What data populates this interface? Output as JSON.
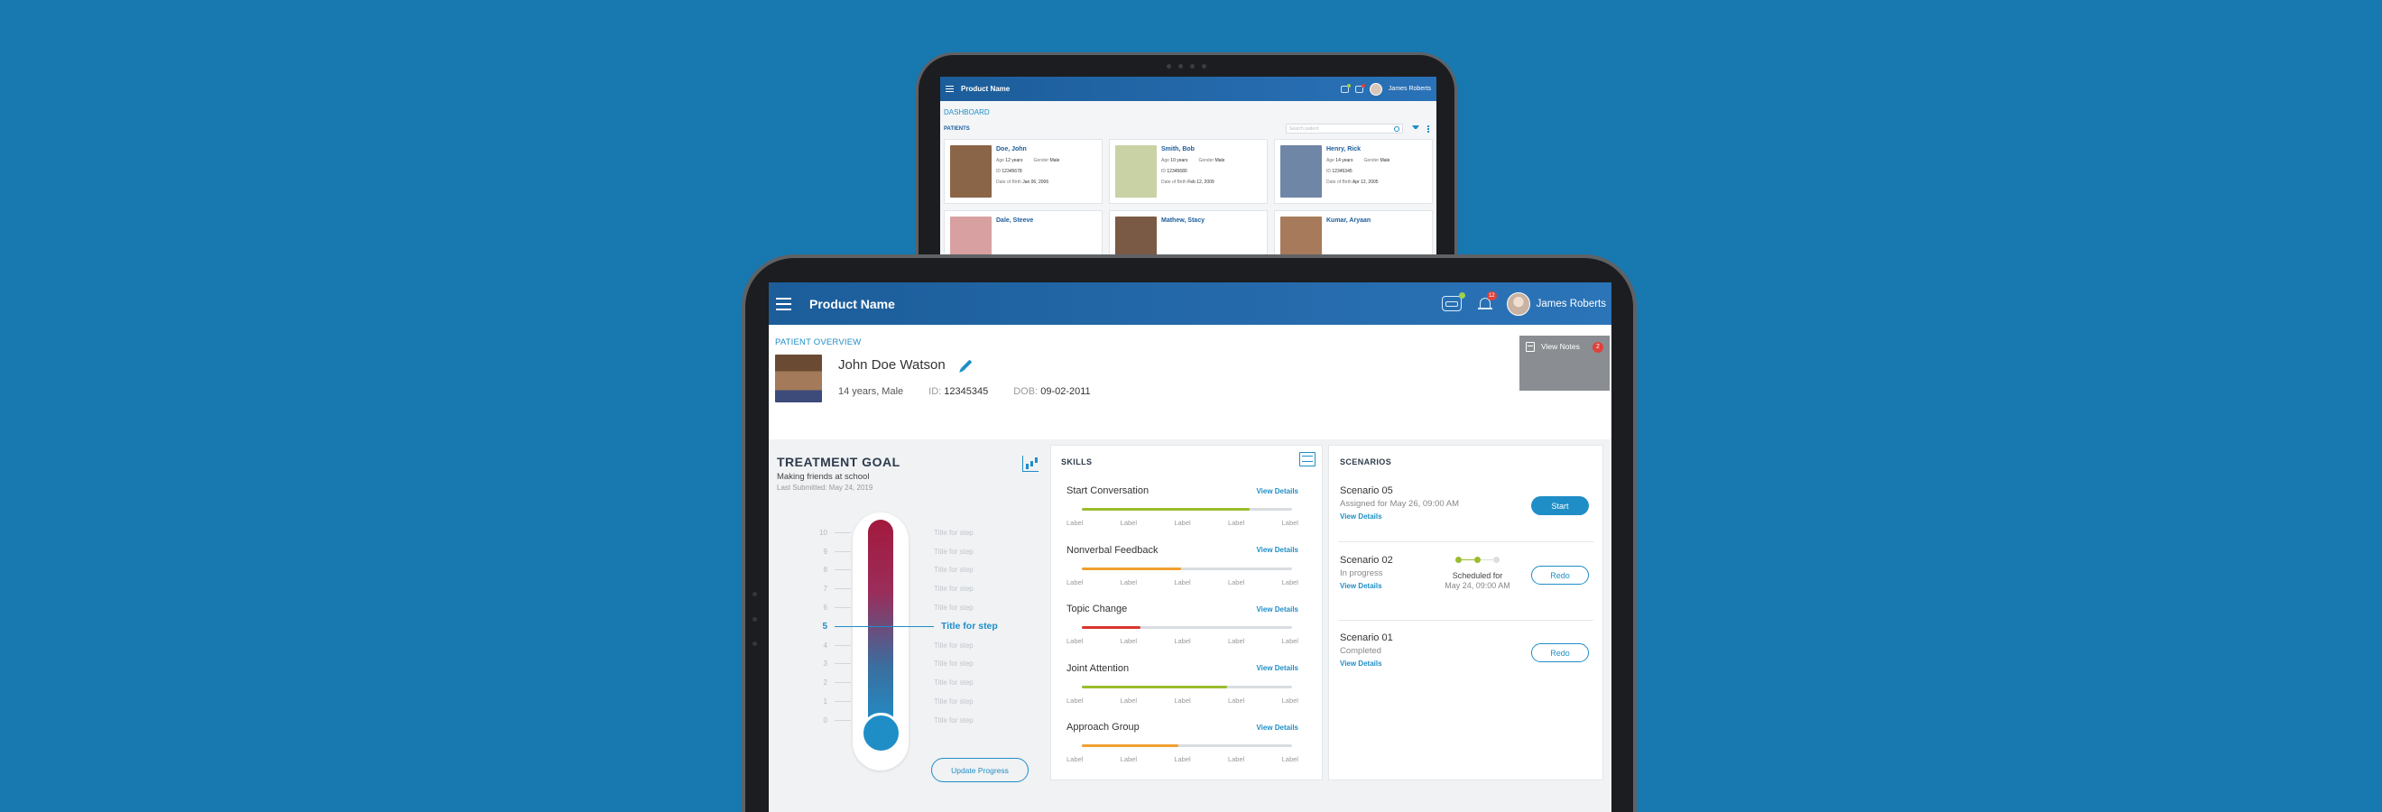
{
  "back_screen": {
    "header": {
      "title": "Product Name",
      "user": "James Roberts"
    },
    "breadcrumb": "DASHBOARD",
    "section_label": "PATIENTS",
    "search_placeholder": "Search patient",
    "patients": [
      {
        "name": "Doe, John",
        "age_label": "Age",
        "age": "12 years",
        "gender_label": "Gender",
        "gender": "Male",
        "id_label": "ID",
        "id": "12345678",
        "dob_label": "Date of Birth",
        "dob": "Jan 06, 2006",
        "photo_color": "#8a6548"
      },
      {
        "name": "Smith, Bob",
        "age_label": "Age",
        "age": "10 years",
        "gender_label": "Gender",
        "gender": "Male",
        "id_label": "ID",
        "id": "12345680",
        "dob_label": "Date of Birth",
        "dob": "Feb 12, 2009",
        "photo_color": "#c9d2a4"
      },
      {
        "name": "Henry, Rick",
        "age_label": "Age",
        "age": "14 years",
        "gender_label": "Gender",
        "gender": "Male",
        "id_label": "ID",
        "id": "12345345",
        "dob_label": "Date of Birth",
        "dob": "Apr 12, 2005",
        "photo_color": "#6f86a6"
      },
      {
        "name": "Dale, Steeve",
        "photo_color": "#d8a0a0"
      },
      {
        "name": "Mathew, Stacy",
        "photo_color": "#7a5a45"
      },
      {
        "name": "Kumar, Aryaan",
        "photo_color": "#a67a5a"
      }
    ]
  },
  "header": {
    "title": "Product Name",
    "notification_count": "12",
    "user_name": "James Roberts"
  },
  "overview": {
    "breadcrumb": "PATIENT OVERVIEW",
    "name": "John Doe Watson",
    "age_gender": "14 years, Male",
    "id_label": "ID:",
    "id": "12345345",
    "dob_label": "DOB:",
    "dob": "09-02-2011",
    "notes_label": "View Notes",
    "notes_count": "2"
  },
  "goal": {
    "title": "TREATMENT GOAL",
    "subtitle": "Making friends at school",
    "submitted": "Last Submitted: May 24, 2019",
    "steps": [
      {
        "num": "10",
        "label": "Title for step"
      },
      {
        "num": "9",
        "label": "Title for step"
      },
      {
        "num": "8",
        "label": "Title for step"
      },
      {
        "num": "7",
        "label": "Title for step"
      },
      {
        "num": "6",
        "label": "Title for step"
      },
      {
        "num": "5",
        "label": "Title for step",
        "active": true
      },
      {
        "num": "4",
        "label": "Title for step"
      },
      {
        "num": "3",
        "label": "Title for step"
      },
      {
        "num": "2",
        "label": "Title for step"
      },
      {
        "num": "1",
        "label": "Title for step"
      },
      {
        "num": "0",
        "label": "Title for step"
      }
    ],
    "update_label": "Update Progress"
  },
  "skills": {
    "title": "SKILLS",
    "view_label": "View Details",
    "tick_label": "Label",
    "items": [
      {
        "name": "Start Conversation",
        "progress": 0.8,
        "color": "#9bbc2c"
      },
      {
        "name": "Nonverbal Feedback",
        "progress": 0.47,
        "color": "#f0a030"
      },
      {
        "name": "Topic Change",
        "progress": 0.28,
        "color": "#d9362f"
      },
      {
        "name": "Joint Attention",
        "progress": 0.69,
        "color": "#9bbc2c"
      },
      {
        "name": "Approach Group",
        "progress": 0.46,
        "color": "#f0a030"
      }
    ]
  },
  "scenarios": {
    "title": "SCENARIOS",
    "view_label": "View Details",
    "items": [
      {
        "name": "Scenario 05",
        "status": "Assigned for May 26, 09:00 AM",
        "button": "Start"
      },
      {
        "name": "Scenario 02",
        "status": "In progress",
        "button": "Redo",
        "scheduled_label": "Scheduled for",
        "scheduled_date": "May 24, 09:00 AM"
      },
      {
        "name": "Scenario 01",
        "status": "Completed",
        "button": "Redo"
      }
    ]
  }
}
